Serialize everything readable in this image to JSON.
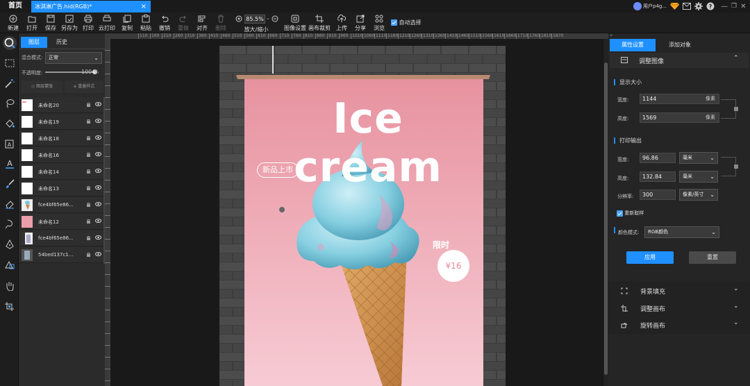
{
  "titlebar": {
    "home_tab": "首页",
    "doc_tab": "冰淇淋广告.hid(RGB)*",
    "user_name": "用户p4g..."
  },
  "toolbar": {
    "items": [
      "新建",
      "打开",
      "保存",
      "另存为",
      "打印",
      "云打印",
      "复制",
      "粘贴",
      "撤销",
      "重做",
      "对齐",
      "删除",
      "放大/缩小",
      "图像设置",
      "画布裁剪",
      "上传",
      "分享",
      "浏览"
    ],
    "zoom_value": "85.5%",
    "auto_select_label": "自动选择"
  },
  "layers_panel": {
    "tabs": [
      "图层",
      "历史"
    ],
    "blend_label": "混合模式:",
    "blend_value": "正常",
    "opacity_label": "不透明度:",
    "opacity_value": "100",
    "opacity_unit": "%",
    "opacity_level": 1.0,
    "action_left": "图层蒙版",
    "action_right": "重叠样式",
    "layers": [
      "未命名20",
      "未命名19",
      "未命名18",
      "未命名16",
      "未命名14",
      "未命名13",
      "fce4bf65e86...",
      "未命名12",
      "fce4bf65e86...",
      "54bed137c1..."
    ]
  },
  "ruler": {
    "ticks": [
      "110",
      "160",
      "210",
      "260",
      "310",
      "360",
      "410",
      "460",
      "510",
      "560",
      "610",
      "660",
      "710",
      "760",
      "810",
      "860",
      "910",
      "960",
      "1010",
      "1060",
      "1110",
      "1160",
      "1210",
      "1260",
      "1310",
      "1360",
      "1410",
      "1460",
      "1510",
      "1560",
      "1610",
      "1660",
      "1710",
      "1760",
      "1810",
      "1870"
    ]
  },
  "poster": {
    "headline": "Ice cream",
    "badge": "新品上市",
    "limited": "限时",
    "price": "¥16"
  },
  "right_panel": {
    "tabs": [
      "属性设置",
      "添加对象"
    ],
    "adjust_image": "调整图像",
    "display_size": "显示大小",
    "width_label": "宽度:",
    "height_label": "高度:",
    "display_width": "1144",
    "display_height": "1569",
    "pixel_unit": "像素",
    "print_output": "打印输出",
    "print_width": "96.86",
    "print_height": "132.84",
    "mm_unit": "毫米",
    "resolution_label": "分辨率:",
    "resolution_value": "300",
    "resolution_unit": "像素/英寸",
    "resample_label": "重新取样",
    "color_mode_label": "颜色模式:",
    "color_mode_value": "RGB颜色",
    "apply_button": "应用",
    "reset_button": "重置",
    "sections": [
      "背景填充",
      "调整画布",
      "旋转画布"
    ]
  },
  "colors": {
    "accent": "#1e90ff",
    "poster_pink": "#ec9fab"
  }
}
